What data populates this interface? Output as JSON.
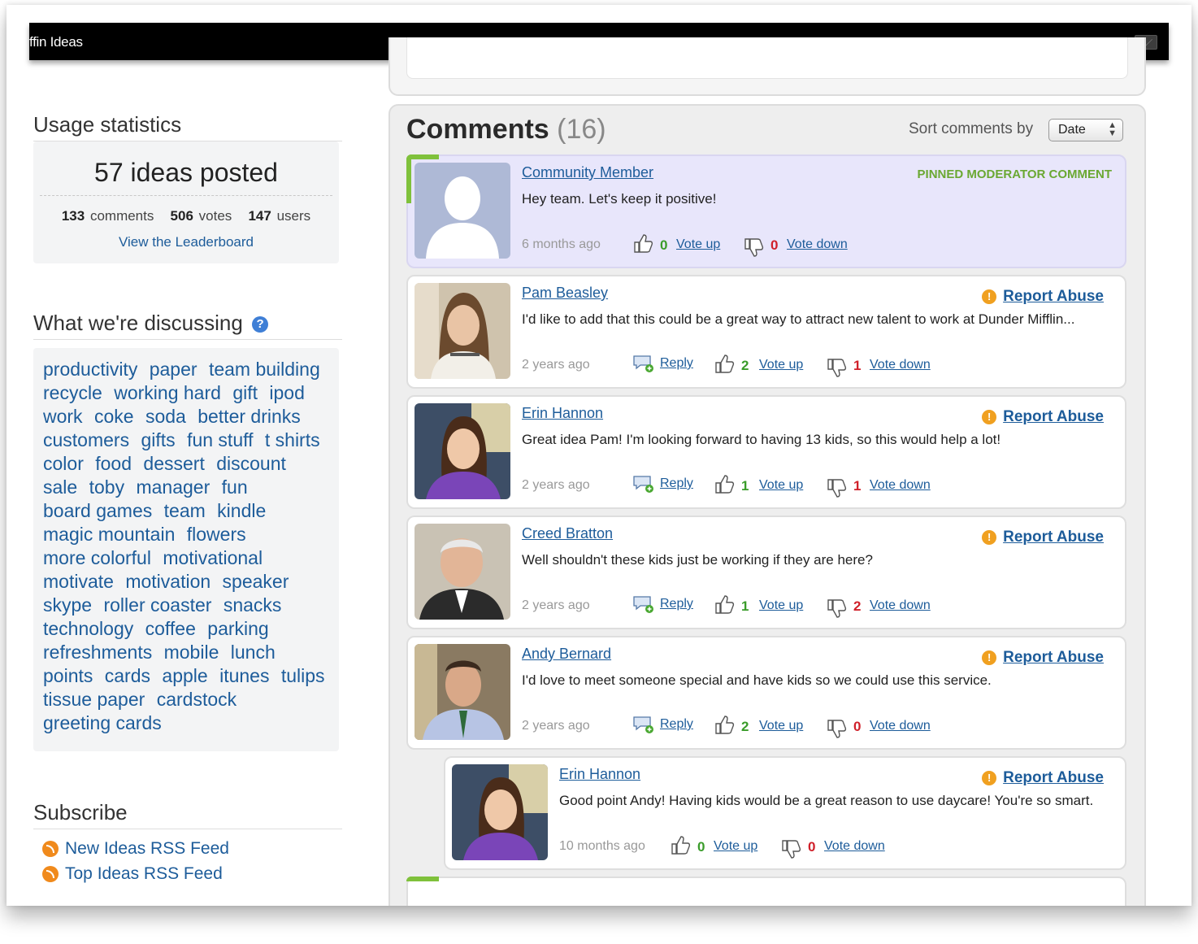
{
  "window": {
    "title": "ffin Ideas"
  },
  "sidebar": {
    "usage": {
      "heading": "Usage statistics",
      "ideas_posted": "57 ideas posted",
      "comments_num": "133",
      "comments_label": "comments",
      "votes_num": "506",
      "votes_label": "votes",
      "users_num": "147",
      "users_label": "users",
      "leaderboard_link": "View the Leaderboard"
    },
    "discussing": {
      "heading": "What we're discussing",
      "help": "?",
      "tags": [
        "productivity",
        "paper",
        "team building",
        "recycle",
        "working hard",
        "gift",
        "ipod",
        "work",
        "coke",
        "soda",
        "better drinks",
        "customers",
        "gifts",
        "fun stuff",
        "t shirts",
        "color",
        "food",
        "dessert",
        "discount",
        "sale",
        "toby",
        "manager",
        "fun",
        "board games",
        "team",
        "kindle",
        "magic mountain",
        "flowers",
        "more colorful",
        "motivational",
        "motivate",
        "motivation",
        "speaker",
        "skype",
        "roller coaster",
        "snacks",
        "technology",
        "coffee",
        "parking",
        "refreshments",
        "mobile",
        "lunch",
        "points",
        "cards",
        "apple",
        "itunes",
        "tulips",
        "tissue paper",
        "cardstock",
        "greeting cards"
      ]
    },
    "subscribe": {
      "heading": "Subscribe",
      "feeds": [
        "New Ideas RSS Feed",
        "Top Ideas RSS Feed"
      ]
    }
  },
  "comments": {
    "title": "Comments",
    "count": "(16)",
    "sort_label": "Sort comments by",
    "sort_value": "Date",
    "pinned": {
      "author": "Community Member",
      "badge": "PINNED MODERATOR COMMENT",
      "text": "Hey team. Let's keep it positive!",
      "time": "6 months ago",
      "up": "0",
      "down": "0",
      "vote_up": "Vote up",
      "vote_down": "Vote down"
    },
    "items": [
      {
        "author": "Pam Beasley",
        "text": "I'd like to add that this could be a great way to attract new talent to work at Dunder Mifflin...",
        "time": "2 years ago",
        "reply": "Reply",
        "up": "2",
        "down": "1",
        "vote_up": "Vote up",
        "vote_down": "Vote down",
        "report": "Report Abuse"
      },
      {
        "author": "Erin Hannon",
        "text": "Great idea Pam! I'm looking forward to having 13 kids, so this would help a lot!",
        "time": "2 years ago",
        "reply": "Reply",
        "up": "1",
        "down": "1",
        "vote_up": "Vote up",
        "vote_down": "Vote down",
        "report": "Report Abuse"
      },
      {
        "author": "Creed Bratton",
        "text": "Well shouldn't these kids just be working if they are here?",
        "time": "2 years ago",
        "reply": "Reply",
        "up": "1",
        "down": "2",
        "vote_up": "Vote up",
        "vote_down": "Vote down",
        "report": "Report Abuse"
      },
      {
        "author": "Andy Bernard",
        "text": "I'd love to meet someone special and have kids so we could use this service.",
        "time": "2 years ago",
        "reply": "Reply",
        "up": "2",
        "down": "0",
        "vote_up": "Vote up",
        "vote_down": "Vote down",
        "report": "Report Abuse"
      }
    ],
    "nested": {
      "author": "Erin Hannon",
      "text": "Good point Andy! Having kids would be a great reason to use daycare! You're so smart.",
      "time": "10 months ago",
      "up": "0",
      "down": "0",
      "vote_up": "Vote up",
      "vote_down": "Vote down",
      "report": "Report Abuse"
    }
  },
  "colors": {
    "link": "#1d5c9a",
    "pinned_bg": "#e8e6fb",
    "accent_green": "#7fc13b",
    "up": "#3a9c2a",
    "down": "#d0202a"
  }
}
